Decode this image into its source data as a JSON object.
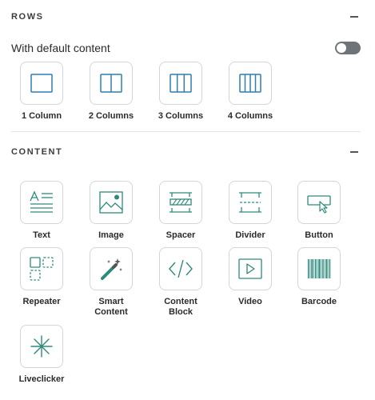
{
  "rows_section": {
    "title": "ROWS",
    "with_default_content_label": "With default content",
    "toggle_on": false,
    "items": [
      {
        "label": "1 Column",
        "icon": "one-column-icon"
      },
      {
        "label": "2 Columns",
        "icon": "two-columns-icon"
      },
      {
        "label": "3 Columns",
        "icon": "three-columns-icon"
      },
      {
        "label": "4 Columns",
        "icon": "four-columns-icon"
      }
    ]
  },
  "content_section": {
    "title": "CONTENT",
    "items": [
      {
        "label": "Text",
        "icon": "text-icon"
      },
      {
        "label": "Image",
        "icon": "image-icon"
      },
      {
        "label": "Spacer",
        "icon": "spacer-icon"
      },
      {
        "label": "Divider",
        "icon": "divider-icon"
      },
      {
        "label": "Button",
        "icon": "button-icon"
      },
      {
        "label": "Repeater",
        "icon": "repeater-icon"
      },
      {
        "label": "Smart\nContent",
        "icon": "magic-wand-icon"
      },
      {
        "label": "Content\nBlock",
        "icon": "code-icon"
      },
      {
        "label": "Video",
        "icon": "video-icon"
      },
      {
        "label": "Barcode",
        "icon": "barcode-icon"
      },
      {
        "label": "Liveclicker",
        "icon": "liveclicker-icon"
      }
    ]
  },
  "colors": {
    "row_icon": "#2e7fb0",
    "content_icon": "#2e8a7c",
    "toggle_off": "#6f7478"
  }
}
